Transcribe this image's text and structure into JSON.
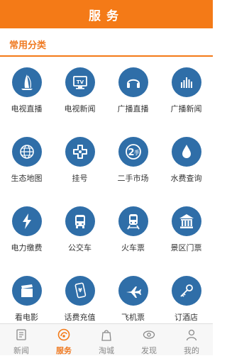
{
  "header": {
    "title": "服务"
  },
  "section": {
    "title": "常用分类"
  },
  "colors": {
    "accent": "#f47a17",
    "icon_bg": "#2f6ea8"
  },
  "grid_items": [
    {
      "label": "电视直播",
      "icon": "sail-icon"
    },
    {
      "label": "电视新闻",
      "icon": "tv-icon"
    },
    {
      "label": "广播直播",
      "icon": "headphones-icon"
    },
    {
      "label": "广播新闻",
      "icon": "equalizer-icon"
    },
    {
      "label": "生态地图",
      "icon": "globe-icon"
    },
    {
      "label": "挂号",
      "icon": "medical-cross-icon"
    },
    {
      "label": "二手市场",
      "icon": "second-hand-icon"
    },
    {
      "label": "水费查询",
      "icon": "water-drop-icon"
    },
    {
      "label": "电力缴费",
      "icon": "lightning-icon"
    },
    {
      "label": "公交车",
      "icon": "bus-icon"
    },
    {
      "label": "火车票",
      "icon": "train-icon"
    },
    {
      "label": "景区门票",
      "icon": "temple-icon"
    },
    {
      "label": "看电影",
      "icon": "clapperboard-icon"
    },
    {
      "label": "话费充值",
      "icon": "phone-recharge-icon"
    },
    {
      "label": "飞机票",
      "icon": "airplane-icon"
    },
    {
      "label": "订酒店",
      "icon": "hotel-key-icon"
    }
  ],
  "tabbar": {
    "items": [
      {
        "label": "新闻",
        "icon": "news-icon",
        "active": false
      },
      {
        "label": "服务",
        "icon": "service-icon",
        "active": true
      },
      {
        "label": "淘城",
        "icon": "shopping-bag-icon",
        "active": false
      },
      {
        "label": "发现",
        "icon": "eye-icon",
        "active": false
      },
      {
        "label": "我的",
        "icon": "user-icon",
        "active": false
      }
    ]
  }
}
